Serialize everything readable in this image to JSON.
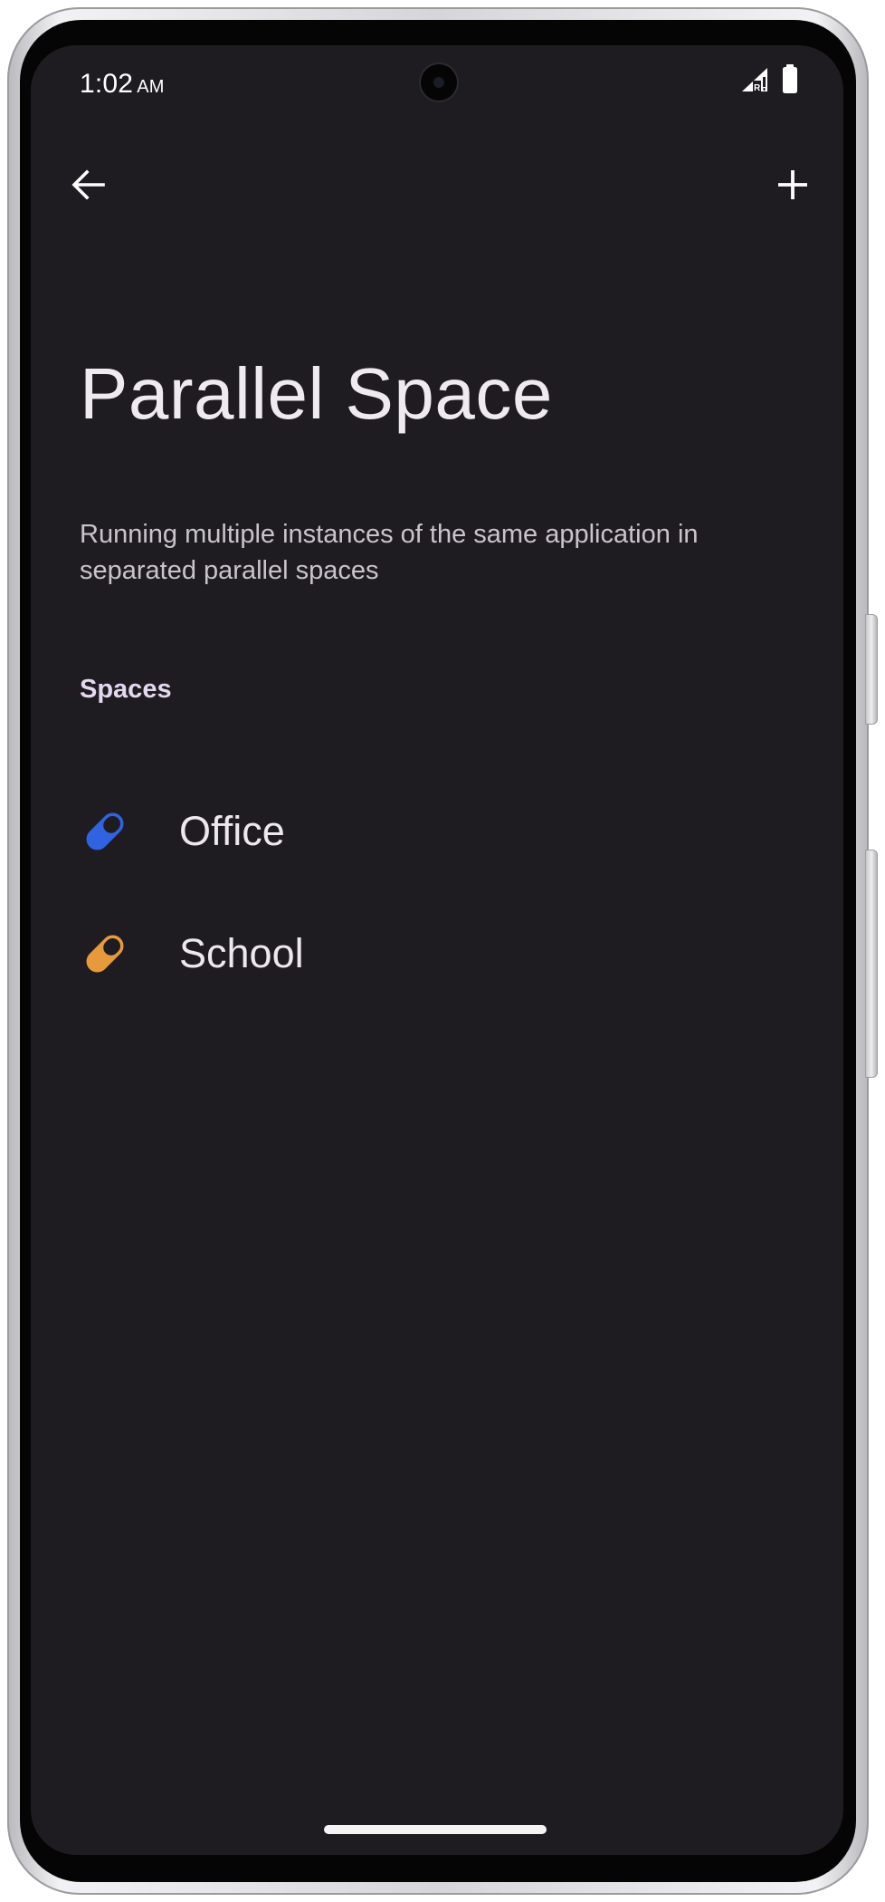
{
  "status_bar": {
    "time": "1:02",
    "ampm": "AM",
    "icons": [
      "signal-roaming-icon",
      "battery-icon"
    ]
  },
  "toolbar": {
    "back_icon": "arrow-left-icon",
    "add_icon": "plus-icon"
  },
  "page": {
    "title": "Parallel Space",
    "description": "Running multiple instances of the same application in separated parallel spaces"
  },
  "spaces_section": {
    "header": "Spaces",
    "items": [
      {
        "label": "Office",
        "icon": "pill-icon",
        "color": "#2f63e0"
      },
      {
        "label": "School",
        "icon": "pill-icon",
        "color": "#e69a3a"
      }
    ]
  },
  "colors": {
    "background": "#1e1c21",
    "accent_header": "#e4d8f0",
    "office": "#2f63e0",
    "school": "#e69a3a"
  }
}
